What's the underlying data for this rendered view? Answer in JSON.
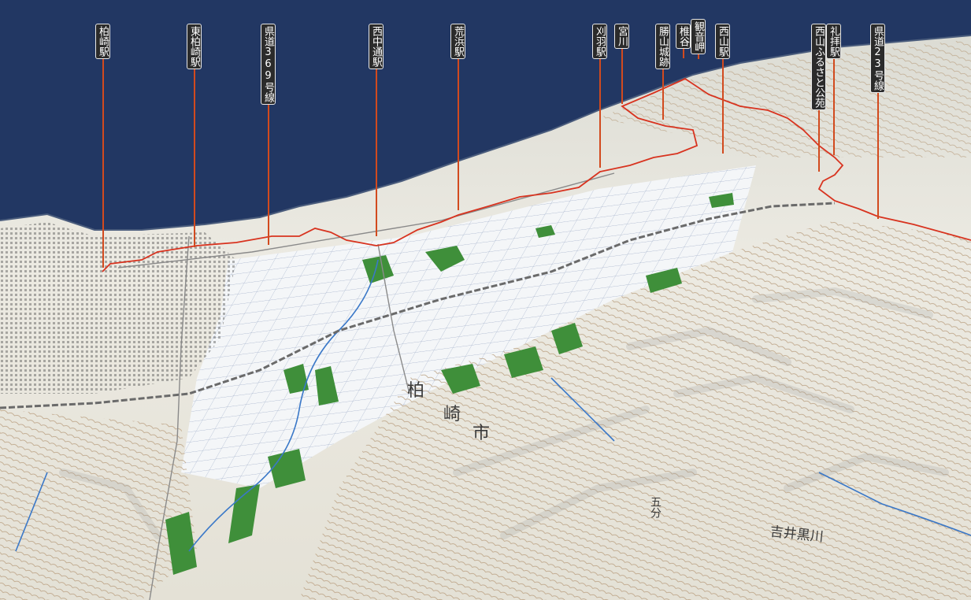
{
  "colors": {
    "sea": "#223763",
    "terrain": "#ebeae4",
    "paddy": "#f4f6f8",
    "forest": "#3f8f3a",
    "route": "#d8331f",
    "leader": "#d24a1e",
    "label_bg": "#2b2b2b"
  },
  "labels": [
    {
      "id": "kashiwazaki-station",
      "text": "柏崎駅"
    },
    {
      "id": "higashi-kashiwazaki-station",
      "text": "東柏崎駅"
    },
    {
      "id": "route-369",
      "text": "県道369号線"
    },
    {
      "id": "nishi-nakadori-station",
      "text": "西中通駅"
    },
    {
      "id": "arahama-station",
      "text": "荒浜駅"
    },
    {
      "id": "kariwa-station",
      "text": "刈羽駅"
    },
    {
      "id": "miyagawa",
      "text": "宮川"
    },
    {
      "id": "katsuyama-castle",
      "text": "勝山城跡"
    },
    {
      "id": "shiiya",
      "text": "椎谷"
    },
    {
      "id": "kannonzaki",
      "text": "観音岬"
    },
    {
      "id": "nishiyama-station",
      "text": "西山駅"
    },
    {
      "id": "nishiyama-furusato-park",
      "text": "西山ふるさと公苑"
    },
    {
      "id": "raihai-station",
      "text": "礼拝駅"
    },
    {
      "id": "route-23",
      "text": "県道23号線"
    }
  ],
  "map_text": {
    "city_char_1": "柏",
    "city_char_2": "崎",
    "city_char_3": "市",
    "river": "吉井黒川",
    "gobun": "五分"
  }
}
